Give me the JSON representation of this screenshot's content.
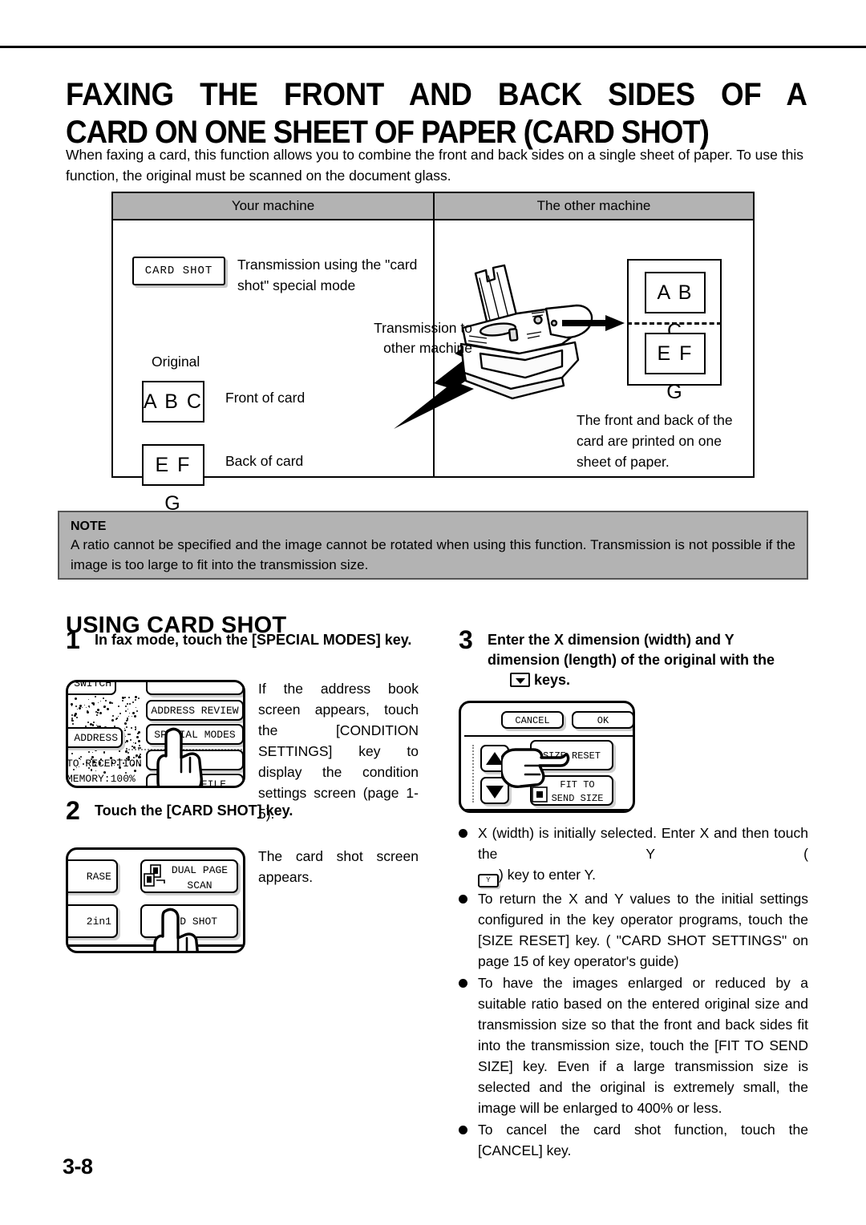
{
  "document": {
    "title_line1": "FAXING THE FRONT AND BACK SIDES OF A",
    "title_line2": "CARD ON ONE SHEET OF PAPER (CARD SHOT)",
    "intro_line1": "When faxing a card, this function allows you to combine the front and back sides on a single sheet of paper. To use",
    "intro_line2": "this function, the original must be scanned on the document glass.",
    "page_number": "3-8"
  },
  "diagram": {
    "header_left": "Your machine",
    "header_right": "The other machine",
    "card_shot_key": "CARD  SHOT",
    "transmission_mode_text": "Transmission using the \"card shot\" special mode",
    "original_label": "Original",
    "front_card_text": "A B C",
    "front_card_label": "Front of card",
    "back_card_text": "E F G",
    "back_card_label": "Back of card",
    "transmission_to_line1": "Transmission to",
    "transmission_to_line2": "other machine",
    "output_top_text": "A B C",
    "output_bottom_text": "E F G",
    "result_text": "The front and back of the card are printed on one sheet of paper."
  },
  "note": {
    "title": "NOTE",
    "line1": "A ratio cannot be specified and the image cannot be rotated when using this function. Transmission is not possible",
    "line2": "if the image is too large to fit into the transmission size."
  },
  "section": {
    "heading": "USING CARD SHOT"
  },
  "steps": [
    {
      "number": "1",
      "title": "In fax mode, touch the [SPECIAL MODES] key.",
      "side_text": "If the address book screen appears, touch the [CONDITION SETTINGS] key to display the condition settings screen (page 1-5).",
      "panel": {
        "partial_top_label": "ODE SWITCH",
        "keys": [
          "ADDRESS REVIEW",
          "SPECIAL MODES",
          "QUICK FILE"
        ],
        "sub_address_label": "UB ADDRESS",
        "auto_reception_label": "TO RECEPTION",
        "memory_label": "MEMORY:100%"
      }
    },
    {
      "number": "2",
      "title": "Touch the [CARD SHOT] key.",
      "side_text": "The card shot screen appears.",
      "panel": {
        "erase_label": "RASE",
        "dual_page_line1": "DUAL PAGE",
        "dual_page_line2": "SCAN",
        "two_in_one_label": "2in1",
        "card_shot_label": "CARD SHOT"
      }
    },
    {
      "number": "3",
      "title_part1": "Enter the X dimension (width) and Y dimension (length) of the original with the",
      "title_part2": "keys.",
      "panel": {
        "cancel_label": "CANCEL",
        "ok_label": "OK",
        "size_reset_label": "SIZE RESET",
        "fit_to_send_line1": "FIT TO",
        "fit_to_send_line2": "SEND SIZE"
      }
    }
  ],
  "bullets": [
    {
      "pre": "X (width) is initially selected. Enter X and then touch the Y (",
      "key": "Y",
      "post": ") key to enter Y."
    },
    {
      "text": "To return the X and Y values to the initial settings configured in the key operator programs, touch the [SIZE RESET] key. ( \"CARD SHOT SETTINGS\" on page 15 of key operator's guide)"
    },
    {
      "text": "To have the images enlarged or reduced by a suitable ratio based on the entered original size and transmission size so that the front and back sides fit into the transmission size, touch the [FIT TO SEND SIZE] key. Even if a large transmission size is selected and the original is extremely small, the image will be enlarged to 400% or less."
    },
    {
      "text": "To cancel the card shot function, touch the [CANCEL] key."
    }
  ],
  "colors": {
    "gray_panel": "#b3b3b3",
    "ink": "#000000",
    "paper": "#ffffff"
  }
}
